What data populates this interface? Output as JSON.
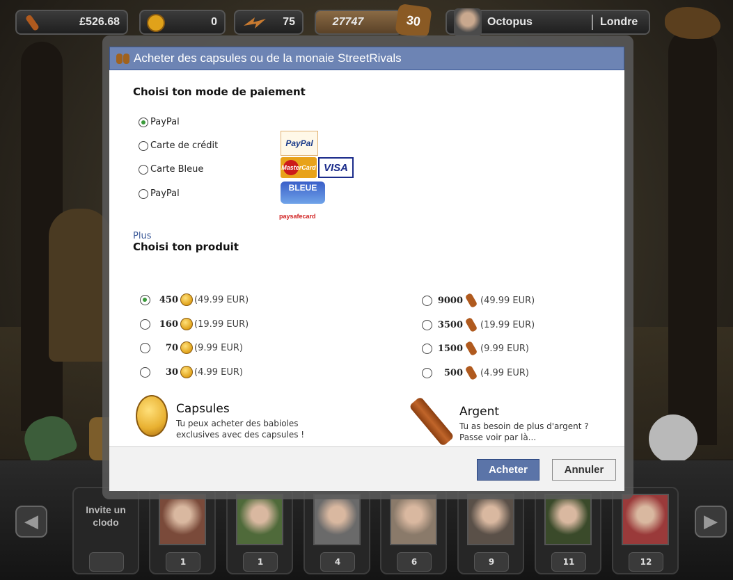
{
  "top_bar": {
    "money": "£526.68",
    "capsules": "0",
    "energy": "75",
    "xp": "27747",
    "level": "30",
    "player_name": "Octopus",
    "city": "Londre"
  },
  "dialog": {
    "title": "Acheter des capsules ou de la monaie StreetRivals",
    "payment_title": "Choisi ton mode de paiement",
    "payment_methods": [
      {
        "label": "PayPal",
        "selected": true
      },
      {
        "label": "Carte de crédit",
        "selected": false
      },
      {
        "label": "Carte Bleue",
        "selected": false
      },
      {
        "label": "PayPal",
        "selected": false
      }
    ],
    "logos": {
      "paypal": "PayPal",
      "mastercard": "MasterCard",
      "visa": "VISA",
      "bleue": "BLEUE",
      "paysafe": "paysafecard"
    },
    "more_link": "Plus",
    "product_title": "Choisi ton produit",
    "capsule_products": [
      {
        "amount": "450",
        "price": "(49.99 EUR)",
        "selected": true
      },
      {
        "amount": "160",
        "price": "(19.99 EUR)",
        "selected": false
      },
      {
        "amount": "70",
        "price": "(9.99 EUR)",
        "selected": false
      },
      {
        "amount": "30",
        "price": "(4.99 EUR)",
        "selected": false
      }
    ],
    "cash_products": [
      {
        "amount": "9000",
        "price": "(49.99 EUR)",
        "selected": false
      },
      {
        "amount": "3500",
        "price": "(19.99 EUR)",
        "selected": false
      },
      {
        "amount": "1500",
        "price": "(9.99 EUR)",
        "selected": false
      },
      {
        "amount": "500",
        "price": "(4.99 EUR)",
        "selected": false
      }
    ],
    "capsules_info": {
      "title": "Capsules",
      "line1": "Tu peux acheter des babioles",
      "line2": "exclusives avec des capsules !"
    },
    "cash_info": {
      "title": "Argent",
      "line1": "Tu as besoin de plus d'argent ?",
      "line2": "Passe voir par là..."
    },
    "buy_label": "Acheter",
    "cancel_label": "Annuler"
  },
  "bottom_bar": {
    "invite_line1": "Invite un",
    "invite_line2": "clodo",
    "friends": [
      {
        "level": "1",
        "photo": "#7a4a3a"
      },
      {
        "level": "1",
        "photo": "#4f6a3a"
      },
      {
        "level": "4",
        "photo": "#6a6a6a"
      },
      {
        "level": "6",
        "photo": "#8a7a6a"
      },
      {
        "level": "9",
        "photo": "#5a5048"
      },
      {
        "level": "11",
        "photo": "#3a4a2a"
      },
      {
        "level": "12",
        "photo": "#9a3a3a"
      }
    ]
  },
  "colors": {
    "header_blue": "#6d84b4",
    "link_blue": "#3b5998",
    "buy_button": "#5b74a8"
  }
}
